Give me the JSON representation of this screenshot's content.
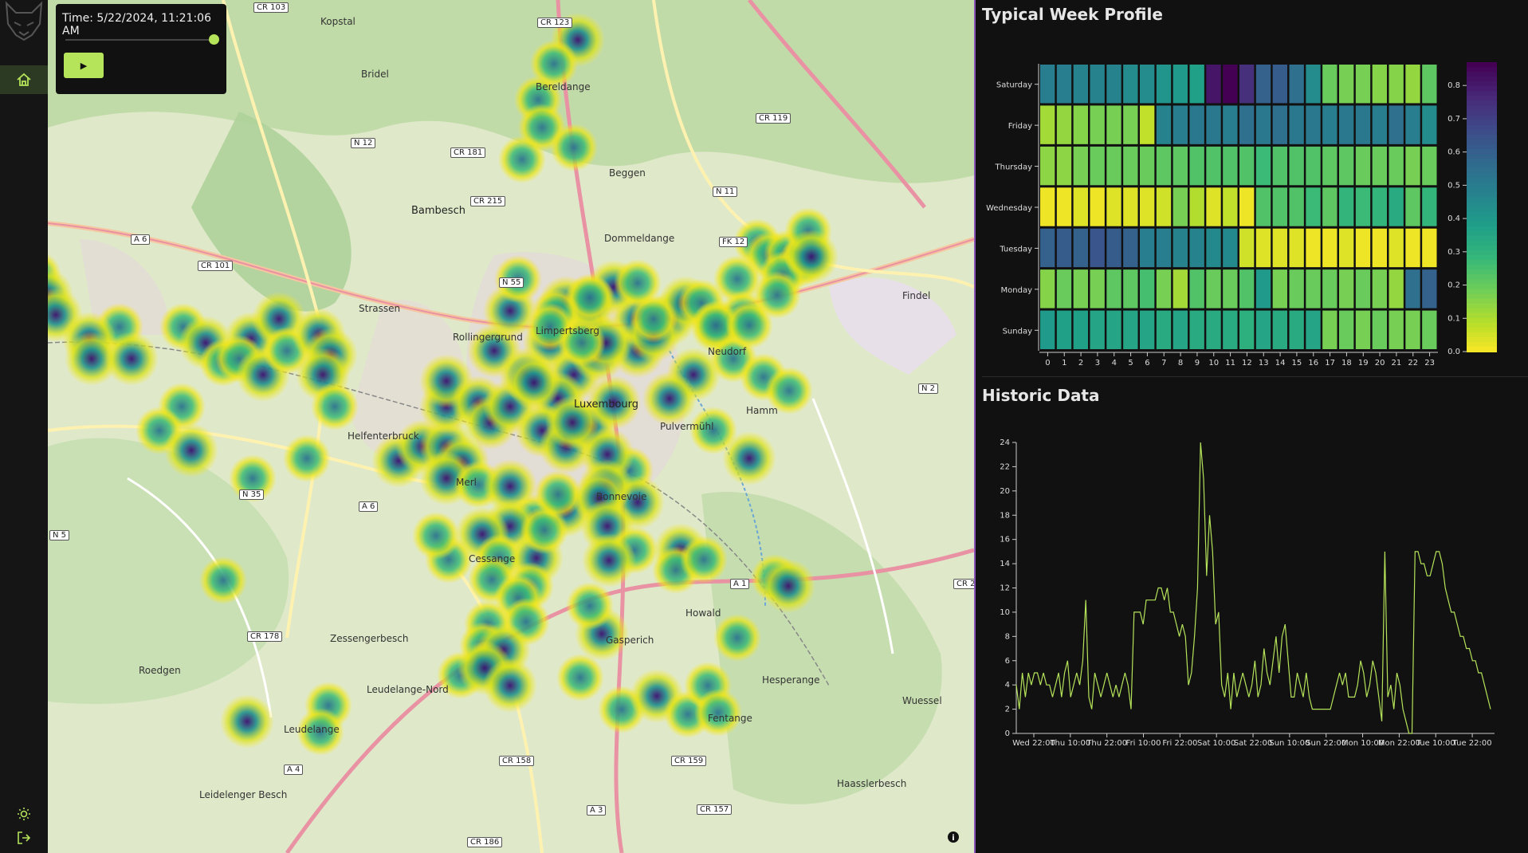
{
  "sidebar": {
    "logo_icon": "fox-head-logo",
    "home_icon": "home-icon",
    "theme_icon": "sun-icon",
    "logout_icon": "logout-icon",
    "accent": "#b5e35a"
  },
  "time_control": {
    "label": "Time: 5/22/2024, 11:21:06 AM",
    "slider_progress": 0.99,
    "play_label": "▶"
  },
  "map": {
    "places": [
      {
        "name": "Kopstal"
      },
      {
        "name": "Bridel"
      },
      {
        "name": "Bereldange"
      },
      {
        "name": "Beggen"
      },
      {
        "name": "Bambesch"
      },
      {
        "name": "Dommeldange"
      },
      {
        "name": "Rollingergrund"
      },
      {
        "name": "Limpertsberg"
      },
      {
        "name": "Neudorf"
      },
      {
        "name": "Findel"
      },
      {
        "name": "Hamm"
      },
      {
        "name": "Luxembourg"
      },
      {
        "name": "Pulvermühl"
      },
      {
        "name": "Merl"
      },
      {
        "name": "Strassen"
      },
      {
        "name": "Helfenterbruck"
      },
      {
        "name": "Cessange"
      },
      {
        "name": "Gasperich"
      },
      {
        "name": "Roedgen"
      },
      {
        "name": "Leudelange"
      },
      {
        "name": "Howald"
      },
      {
        "name": "Hesperange"
      },
      {
        "name": "Fentange"
      },
      {
        "name": "Leudelange-Nord"
      },
      {
        "name": "Zessengerbesch"
      },
      {
        "name": "Wuessel"
      },
      {
        "name": "Haasslerbesch"
      },
      {
        "name": "Leidelenger Besch"
      },
      {
        "name": "Bonnevoie"
      }
    ],
    "road_tags": [
      "CR 103",
      "CR 123",
      "CR 119",
      "N 12",
      "CR 181",
      "CR 215",
      "N 11",
      "A 6",
      "CR 101",
      "N 55",
      "FK 12",
      "N 2",
      "N 35",
      "A 6",
      "N 5",
      "CR 178",
      "A 1",
      "CR 158",
      "CR 159",
      "A 4",
      "A 3",
      "CR 157",
      "CR 186",
      "CR 2"
    ],
    "attribution_icon": "info-icon"
  },
  "week_profile": {
    "title": "Typical Week Profile",
    "days": [
      "Saturday",
      "Friday",
      "Thursday",
      "Wednesday",
      "Tuesday",
      "Monday",
      "Sunday"
    ],
    "hours": [
      "0",
      "1",
      "2",
      "3",
      "4",
      "5",
      "6",
      "7",
      "8",
      "9",
      "10",
      "11",
      "12",
      "13",
      "14",
      "15",
      "16",
      "17",
      "18",
      "19",
      "20",
      "21",
      "22",
      "23"
    ],
    "values": [
      [
        0.5,
        0.5,
        0.48,
        0.48,
        0.48,
        0.45,
        0.45,
        0.42,
        0.4,
        0.38,
        0.82,
        0.88,
        0.75,
        0.6,
        0.62,
        0.55,
        0.45,
        0.2,
        0.18,
        0.18,
        0.16,
        0.16,
        0.14,
        0.22
      ],
      [
        0.12,
        0.14,
        0.16,
        0.18,
        0.18,
        0.18,
        0.08,
        0.48,
        0.5,
        0.52,
        0.52,
        0.5,
        0.55,
        0.52,
        0.55,
        0.52,
        0.52,
        0.5,
        0.52,
        0.52,
        0.5,
        0.55,
        0.5,
        0.45
      ],
      [
        0.15,
        0.15,
        0.18,
        0.2,
        0.2,
        0.2,
        0.2,
        0.22,
        0.22,
        0.24,
        0.24,
        0.24,
        0.24,
        0.28,
        0.24,
        0.24,
        0.24,
        0.22,
        0.22,
        0.2,
        0.2,
        0.2,
        0.18,
        0.2
      ],
      [
        0.02,
        0.02,
        0.04,
        0.02,
        0.04,
        0.04,
        0.04,
        0.06,
        0.18,
        0.1,
        0.04,
        0.08,
        0.02,
        0.24,
        0.24,
        0.24,
        0.28,
        0.22,
        0.3,
        0.28,
        0.3,
        0.34,
        0.22,
        0.3
      ],
      [
        0.6,
        0.62,
        0.6,
        0.64,
        0.62,
        0.6,
        0.5,
        0.5,
        0.48,
        0.48,
        0.46,
        0.46,
        0.06,
        0.04,
        0.04,
        0.04,
        0.02,
        0.02,
        0.04,
        0.02,
        0.02,
        0.04,
        0.02,
        0.02
      ],
      [
        0.16,
        0.2,
        0.18,
        0.18,
        0.22,
        0.22,
        0.26,
        0.18,
        0.12,
        0.24,
        0.2,
        0.2,
        0.24,
        0.4,
        0.18,
        0.2,
        0.2,
        0.2,
        0.18,
        0.2,
        0.18,
        0.14,
        0.55,
        0.6
      ],
      [
        0.4,
        0.38,
        0.38,
        0.36,
        0.36,
        0.36,
        0.36,
        0.34,
        0.36,
        0.34,
        0.34,
        0.34,
        0.32,
        0.36,
        0.34,
        0.34,
        0.36,
        0.18,
        0.2,
        0.18,
        0.2,
        0.18,
        0.18,
        0.2
      ]
    ],
    "colorbar_ticks": [
      "0.0",
      "0.1",
      "0.2",
      "0.3",
      "0.4",
      "0.5",
      "0.6",
      "0.7",
      "0.8"
    ],
    "colorbar_range": [
      0,
      0.87
    ],
    "palette": "viridis (reversed: yellow low, purple high)"
  },
  "chart_data": {
    "type": "line",
    "title": "Historic Data",
    "xlabel": "",
    "ylabel": "",
    "ylim": [
      0,
      24
    ],
    "y_ticks": [
      "0",
      "2",
      "4",
      "6",
      "8",
      "10",
      "12",
      "14",
      "16",
      "18",
      "20",
      "22",
      "24"
    ],
    "x_ticks": [
      "Wed 22:00",
      "Thu 10:00",
      "Thu 22:00",
      "Fri 10:00",
      "Fri 22:00",
      "Sat 10:00",
      "Sat 22:00",
      "Sun 10:00",
      "Sun 22:00",
      "Mon 10:00",
      "Mon 22:00",
      "Tue 10:00",
      "Tue 22:00"
    ],
    "x_range_hours": [
      0,
      157
    ],
    "color": "#b5e35a",
    "series": [
      {
        "x": [
          0,
          1,
          2,
          3,
          4,
          5,
          6,
          7,
          8,
          9,
          10,
          11,
          12,
          13,
          14,
          15,
          16,
          17,
          18,
          19,
          20,
          21,
          22,
          23,
          24,
          25,
          26,
          27,
          28,
          29,
          30,
          31,
          32,
          33,
          34,
          35,
          36,
          37,
          38,
          39,
          40,
          41,
          42,
          43,
          44,
          45,
          46,
          47,
          48,
          49,
          50,
          51,
          52,
          53,
          54,
          55,
          56,
          57,
          58,
          59,
          60,
          61,
          62,
          63,
          64,
          65,
          66,
          67,
          68,
          69,
          70,
          71,
          72,
          73,
          74,
          75,
          76,
          77,
          78,
          79,
          80,
          81,
          82,
          83,
          84,
          85,
          86,
          87,
          88,
          89,
          90,
          91,
          92,
          93,
          94,
          95,
          96,
          97,
          98,
          99,
          100,
          101,
          102,
          103,
          104,
          105,
          106,
          107,
          108,
          109,
          110,
          111,
          112,
          113,
          114,
          115,
          116,
          117,
          118,
          119,
          120,
          121,
          122,
          123,
          124,
          125,
          126,
          127,
          128,
          129,
          130,
          131,
          132,
          133,
          134,
          135,
          136,
          137,
          138,
          139,
          140,
          141,
          142,
          143,
          144,
          145,
          146,
          147,
          148,
          149,
          150,
          151,
          152,
          153,
          154,
          155,
          156,
          157
        ],
        "y": [
          4,
          2,
          5,
          3,
          5,
          4,
          5,
          5,
          4,
          5,
          4,
          4,
          3,
          4,
          5,
          3,
          5,
          6,
          3,
          4,
          5,
          4,
          6,
          11,
          3,
          2,
          5,
          4,
          3,
          4,
          5,
          4,
          3,
          4,
          3,
          4,
          5,
          4,
          2,
          10,
          10,
          10,
          9,
          11,
          11,
          11,
          11,
          12,
          12,
          11,
          12,
          10,
          10,
          9,
          8,
          9,
          8,
          4,
          5,
          8,
          12,
          24,
          21,
          13,
          18,
          15,
          9,
          10,
          4,
          3,
          5,
          2,
          5,
          3,
          4,
          5,
          4,
          3,
          4,
          6,
          3,
          4,
          7,
          5,
          4,
          6,
          8,
          5,
          8,
          9,
          6,
          3,
          3,
          5,
          4,
          3,
          5,
          3,
          2,
          2,
          2,
          2,
          2,
          2,
          2,
          3,
          4,
          5,
          4,
          5,
          3,
          3,
          3,
          4,
          6,
          5,
          3,
          4,
          6,
          5,
          3,
          1,
          15,
          3,
          4,
          2,
          5,
          4,
          2,
          1,
          0,
          0,
          15,
          15,
          14,
          14,
          13,
          13,
          14,
          15,
          15,
          14,
          12,
          11,
          10,
          10,
          9,
          8,
          8,
          7,
          7,
          6,
          6,
          5,
          5,
          4,
          3,
          2
        ]
      }
    ]
  }
}
